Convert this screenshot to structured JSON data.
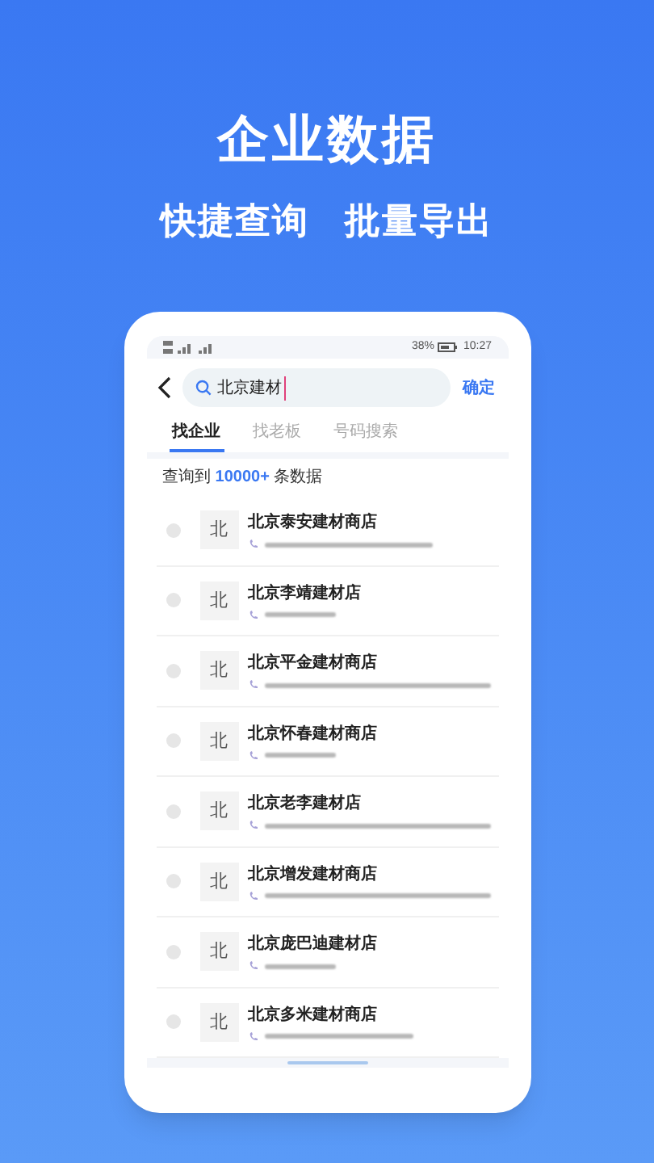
{
  "headline": "企业数据",
  "subtitle": [
    "快捷查询",
    "批量导出"
  ],
  "phone": {
    "status_bar": {
      "battery": "38%",
      "time": "10:27"
    },
    "search": {
      "value": "北京建材",
      "confirm": "确定"
    },
    "tabs": [
      {
        "label": "找企业",
        "selected": true
      },
      {
        "label": "找老板",
        "selected": false
      },
      {
        "label": "号码搜索",
        "selected": false
      }
    ],
    "result_count": {
      "prefix": "查询到",
      "count": "10000+",
      "suffix": "条数据"
    },
    "companies": [
      {
        "avatar": "北",
        "name": "北京泰安建材商店",
        "selected": false,
        "kind": "long"
      },
      {
        "avatar": "北",
        "name": "北京李靖建材店",
        "selected": false,
        "kind": "short"
      },
      {
        "avatar": "北",
        "name": "北京平金建材商店",
        "selected": false,
        "kind": "full"
      },
      {
        "avatar": "北",
        "name": "北京怀春建材商店",
        "selected": false,
        "kind": "short"
      },
      {
        "avatar": "北",
        "name": "北京老李建材店",
        "selected": false,
        "kind": "full"
      },
      {
        "avatar": "北",
        "name": "北京增发建材商店",
        "selected": false,
        "kind": "full"
      },
      {
        "avatar": "北",
        "name": "北京庞巴迪建材店",
        "selected": false,
        "kind": "short"
      },
      {
        "avatar": "北",
        "name": "北京多米建材商店",
        "selected": false,
        "kind": "medium"
      }
    ]
  }
}
